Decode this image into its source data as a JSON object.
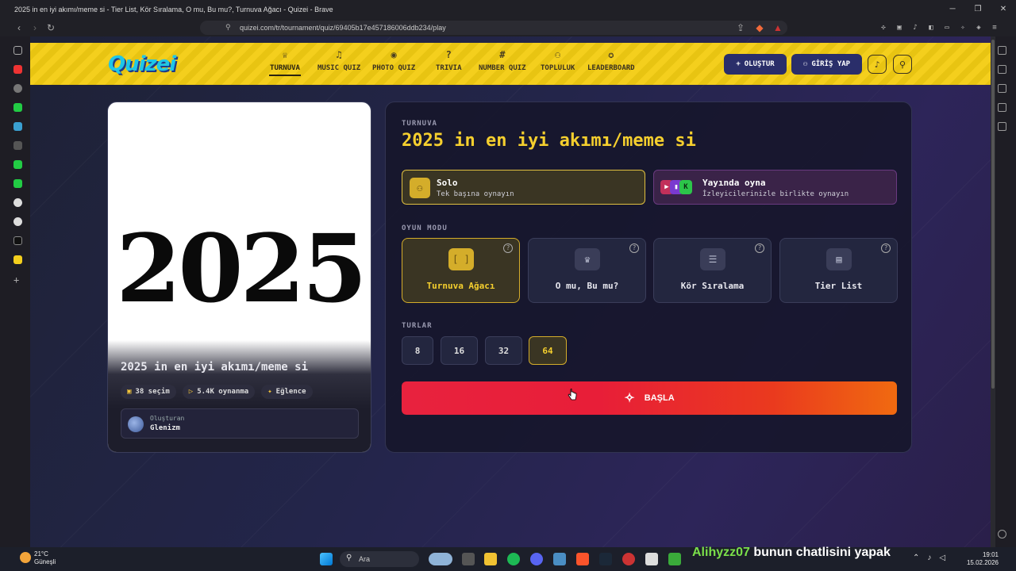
{
  "browser": {
    "window_title": "2025 in en iyi akımı/meme si - Tier List, Kör Sıralama, O mu, Bu mu?, Turnuva Ağacı - Quizei - Brave",
    "url": "quizei.com/tr/tournament/quiz/69405b17e457186006ddb234/play",
    "minimize": "─",
    "maximize": "❐",
    "close": "✕"
  },
  "header": {
    "logo": "Quizei",
    "nav": [
      {
        "label": "TURNUVA",
        "icon": "trophy-icon",
        "glyph": "♕",
        "active": true
      },
      {
        "label": "MUSIC QUIZ",
        "icon": "music-icon",
        "glyph": "♫"
      },
      {
        "label": "PHOTO QUIZ",
        "icon": "camera-icon",
        "glyph": "◉"
      },
      {
        "label": "TRIVIA",
        "icon": "question-icon",
        "glyph": "?"
      },
      {
        "label": "NUMBER QUIZ",
        "icon": "hash-icon",
        "glyph": "#"
      },
      {
        "label": "TOPLULUK",
        "icon": "users-icon",
        "glyph": "⚇"
      },
      {
        "label": "LEADERBOARD",
        "icon": "medal-icon",
        "glyph": "✪"
      }
    ],
    "create_label": "OLUŞTUR",
    "login_label": "GİRİŞ YAP"
  },
  "quiz_card": {
    "image_text": "2025",
    "title": "2025 in en iyi akımı/meme si",
    "choices": "38 seçim",
    "plays": "5.4K oynanma",
    "category": "Eğlence",
    "creator_label": "Oluşturan",
    "creator_name": "Glenizm"
  },
  "setup": {
    "section_label": "TURNUVA",
    "title": "2025 in en iyi akımı/meme si",
    "solo_title": "Solo",
    "solo_sub": "Tek başına oynayın",
    "live_title": "Yayında oyna",
    "live_sub": "İzleyicilerinizle birlikte oynayın",
    "mode_label": "OYUN MODU",
    "modes": [
      {
        "label": "Turnuva Ağacı",
        "glyph": "[ ]",
        "active": true
      },
      {
        "label": "O mu, Bu mu?",
        "glyph": "♛"
      },
      {
        "label": "Kör Sıralama",
        "glyph": "☰"
      },
      {
        "label": "Tier List",
        "glyph": "▤"
      }
    ],
    "rounds_label": "TURLAR",
    "rounds": [
      "8",
      "16",
      "32",
      "64"
    ],
    "selected_round": "64",
    "start_label": "BAŞLA"
  },
  "taskbar": {
    "temperature": "21°C",
    "weather": "Güneşli",
    "search_placeholder": "Ara",
    "chat_user": "Alihyzz07",
    "chat_message": "bunun chatlisini yapak",
    "time": "19:01",
    "date": "15.02.2026"
  }
}
